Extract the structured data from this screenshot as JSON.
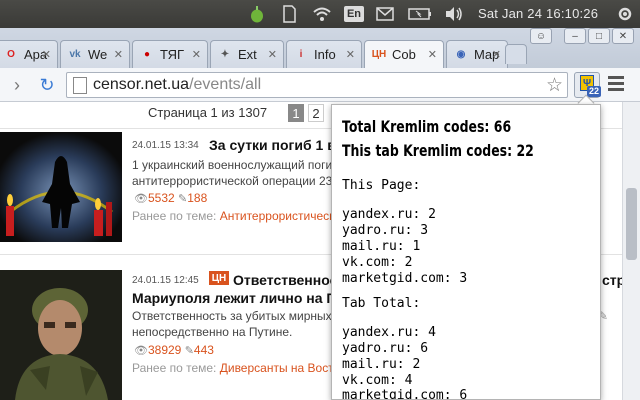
{
  "system_bar": {
    "keyboard_layout": "En",
    "clock": "Sat Jan 24 16:10:26"
  },
  "tabs": [
    {
      "label": "Apa",
      "favicon": "opera-icon",
      "color": "#d22"
    },
    {
      "label": "We",
      "favicon": "vk-icon",
      "color": "#4a76a8"
    },
    {
      "label": "ТЯГ",
      "favicon": "red-circle-icon",
      "color": "#c00"
    },
    {
      "label": "Ext",
      "favicon": "puzzle-icon",
      "color": "#555"
    },
    {
      "label": "Info",
      "favicon": "info-icon",
      "color": "#c33"
    },
    {
      "label": "Cob",
      "favicon": "cn-icon",
      "color": "#d9531e",
      "active": true
    },
    {
      "label": "Map",
      "favicon": "compass-icon",
      "color": "#3a64b8"
    }
  ],
  "toolbar": {
    "url_host": "censor.net.ua",
    "url_path": "/events/all",
    "ext_badge": "22"
  },
  "page": {
    "pagination_text": "Страница 1 из 1307",
    "pages": [
      "1",
      "2"
    ],
    "news": [
      {
        "date": "24.01.15 13:34",
        "title": "За сутки погиб 1 в",
        "lines": [
          "1 украинский военнослужащий погиб",
          "антитеррористической операции 23"
        ],
        "views": "5532",
        "comments": "188",
        "related_prefix": "Ранее по теме:",
        "related_link": "Антитеррористическ"
      },
      {
        "date": "24.01.15 12:45",
        "badge": "ЦН",
        "title": "Ответственность",
        "title_tail": "стр",
        "title2": "Мариуполя лежит лично на П",
        "lines": [
          "Ответственность за убитых мирных",
          "непосредственно на Путине."
        ],
        "views": "38929",
        "comments": "443",
        "related_prefix": "Ранее по теме:",
        "related_link": "Диверсанты на Вост"
      }
    ]
  },
  "popup": {
    "total_line": "Total Kremlim codes: 66",
    "tab_line": "This tab Kremlim codes: 22",
    "this_page_header": "This Page:",
    "this_page": [
      "yandex.ru: 2",
      "yadro.ru: 3",
      "mail.ru: 1",
      "vk.com: 2",
      "marketgid.com: 3"
    ],
    "tab_total_header": "Tab Total:",
    "tab_total": [
      "yandex.ru: 4",
      "yadro.ru: 6",
      "mail.ru: 2",
      "vk.com: 4",
      "marketgid.com: 6"
    ]
  }
}
